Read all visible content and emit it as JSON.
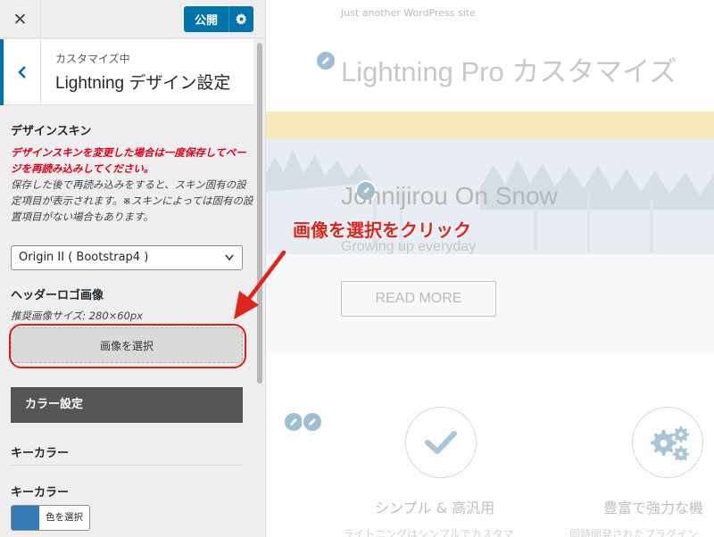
{
  "topbar": {
    "close_glyph": "✕",
    "publish_label": "公開"
  },
  "section": {
    "customizing_label": "カスタマイズ中",
    "title": "Lightning デザイン設定"
  },
  "design_skin": {
    "heading": "デザインスキン",
    "warning": "デザインスキンを変更した場合は一度保存してページを再読み込みしてください。",
    "description": "保存した後で再読み込みをすると、スキン固有の設定項目が表示されます。※スキンによっては固有の設置項目がない場合もあります。",
    "selected_option": "Origin II ( Bootstrap4 )"
  },
  "header_logo": {
    "heading": "ヘッダーロゴ画像",
    "recommended_size": "推奨画像サイズ: 280×60px",
    "select_button": "画像を選択"
  },
  "color_settings": {
    "button_label": "カラー設定",
    "key_color_heading": "キーカラー",
    "key_color_label": "キーカラー",
    "picker_label": "色を選択",
    "key_color_value": "#337ab7"
  },
  "preview": {
    "tagline": "Just another WordPress site",
    "site_title": "Lightning Pro カスタマイズ",
    "hero_title": "Jonnijirou On Snow",
    "hero_subtitle": "Growing up everyday",
    "read_more": "READ MORE",
    "features": [
      {
        "title": "シンプル & 高汎用",
        "text": "ライトニングはシンプルでカスタマ",
        "icon": "check-icon"
      },
      {
        "title": "豊富で強力な機",
        "text": "同時開発されたプラグイン",
        "icon": "gears-icon"
      }
    ]
  },
  "annotation": {
    "text": "画像を選択をクリック",
    "color": "#e0251d"
  },
  "colors": {
    "accent": "#0073aa",
    "dark_button": "#555555",
    "warning": "#e0001b"
  }
}
